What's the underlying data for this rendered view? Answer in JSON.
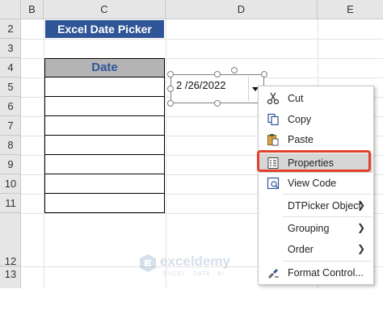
{
  "columns": [
    "B",
    "C",
    "D",
    "E"
  ],
  "rows": [
    "2",
    "3",
    "4",
    "5",
    "6",
    "7",
    "8",
    "9",
    "10",
    "11",
    "12",
    "13"
  ],
  "banner": {
    "title": "Excel Date Picker"
  },
  "table": {
    "header": "Date",
    "row_count": 7
  },
  "date_picker": {
    "value": "2 /26/2022"
  },
  "context_menu": {
    "items": [
      {
        "label": "Cut",
        "icon": "scissors-icon"
      },
      {
        "label": "Copy",
        "icon": "copy-icon"
      },
      {
        "label": "Paste",
        "icon": "paste-icon"
      },
      {
        "label": "Properties",
        "icon": "properties-icon",
        "highlighted": true
      },
      {
        "label": "View Code",
        "icon": "view-code-icon"
      },
      {
        "label": "DTPicker Object",
        "submenu": true
      },
      {
        "label": "Grouping",
        "submenu": true
      },
      {
        "label": "Order",
        "submenu": true
      },
      {
        "label": "Format Control...",
        "icon": "format-control-icon"
      }
    ]
  },
  "watermark": {
    "name": "exceldemy",
    "tagline": "EXCEL · DATA · BI"
  },
  "colors": {
    "banner_bg": "#2f5597",
    "highlight_border": "#e0412b",
    "table_header_bg": "#b4b4b4"
  }
}
